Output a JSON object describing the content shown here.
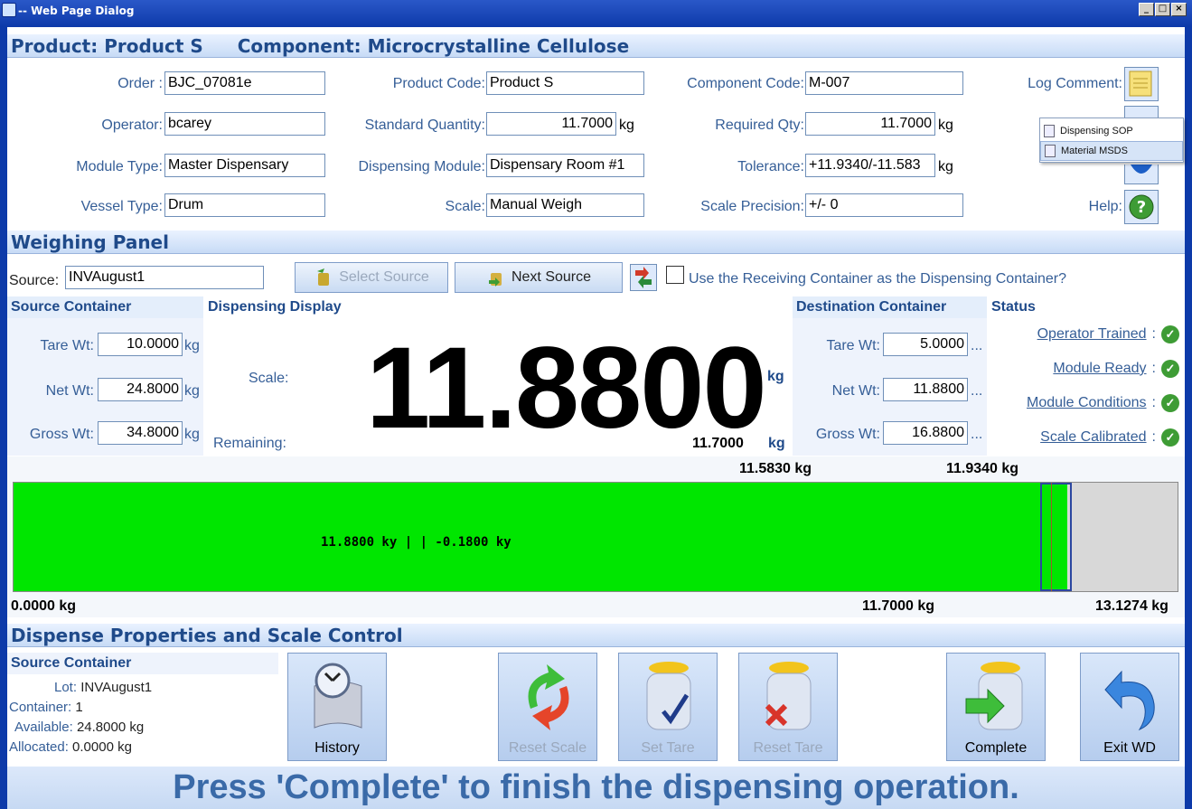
{
  "window": {
    "title": "-- Web Page Dialog"
  },
  "header": {
    "product_label": "Product: Product S",
    "component_label": "Component: Microcrystalline Cellulose"
  },
  "info": {
    "order_label": "Order :",
    "order": "BJC_07081e",
    "operator_label": "Operator:",
    "operator": "bcarey",
    "module_type_label": "Module Type:",
    "module_type": "Master Dispensary",
    "vessel_type_label": "Vessel Type:",
    "vessel_type": "Drum",
    "product_code_label": "Product Code:",
    "product_code": "Product S",
    "standard_quantity_label": "Standard Quantity:",
    "standard_quantity": "11.7000",
    "dispensing_module_label": "Dispensing Module:",
    "dispensing_module": "Dispensary Room #1",
    "scale_label": "Scale:",
    "scale": "Manual Weigh",
    "component_code_label": "Component Code:",
    "component_code": "M-007",
    "required_qty_label": "Required Qty:",
    "required_qty": "11.7000",
    "tolerance_label": "Tolerance:",
    "tolerance": "+11.9340/-11.583",
    "scale_precision_label": "Scale Precision:",
    "scale_precision": "+/- 0",
    "unit": "kg",
    "log_comment_label": "Log Comment:",
    "help_label": "Help:"
  },
  "popup_menu": {
    "items": [
      "Dispensing SOP",
      "Material MSDS"
    ]
  },
  "weighing": {
    "section_title": "Weighing Panel",
    "source_label": "Source:",
    "source_value": "INVAugust1",
    "select_source": "Select Source",
    "next_source": "Next Source",
    "receiving_container_question": "Use the Receiving Container as the Dispensing Container?",
    "source_container_title": "Source Container",
    "dispensing_display_title": "Dispensing Display",
    "destination_container_title": "Destination Container",
    "status_title": "Status",
    "tare_label": "Tare Wt:",
    "net_label": "Net Wt:",
    "gross_label": "Gross Wt:",
    "source_tare": "10.0000",
    "source_net": "24.8000",
    "source_gross": "34.8000",
    "dest_tare": "5.0000",
    "dest_net": "11.8800",
    "dest_gross": "16.8800",
    "ellipsis": "...",
    "scale_caption": "Scale:",
    "remaining_caption": "Remaining:",
    "scale_reading": "11.8800",
    "remaining_value": "11.7000",
    "status": [
      {
        "label": "Operator Trained",
        "ok": true
      },
      {
        "label": "Module Ready",
        "ok": true
      },
      {
        "label": "Module Conditions",
        "ok": true
      },
      {
        "label": "Scale Calibrated",
        "ok": true
      }
    ],
    "colon": ":"
  },
  "progress": {
    "min_label": "0.0000 kg",
    "max_label": "13.1274 kg",
    "low_tol_label": "11.5830 kg",
    "high_tol_label": "11.9340 kg",
    "target_label": "11.7000 kg",
    "bar_text": "11.8800 ky | | -0.1800 ky",
    "min": 0,
    "max": 13.1274,
    "value": 11.88,
    "low_tol": 11.583,
    "high_tol": 11.934,
    "target": 11.7,
    "fill_color": "#00e600"
  },
  "dispense": {
    "section_title": "Dispense Properties and Scale Control",
    "source_container_title": "Source Container",
    "lot_label": "Lot:",
    "lot": "INVAugust1",
    "container_label": "Container:",
    "container": "1",
    "available_label": "Available:",
    "available": "24.8000 kg",
    "allocated_label": "Allocated:",
    "allocated": "0.0000 kg",
    "buttons": {
      "history": "History",
      "reset_scale": "Reset Scale",
      "set_tare": "Set Tare",
      "reset_tare": "Reset Tare",
      "complete": "Complete",
      "exit_wd": "Exit WD"
    }
  },
  "footer": {
    "message": "Press 'Complete' to finish the dispensing operation."
  }
}
